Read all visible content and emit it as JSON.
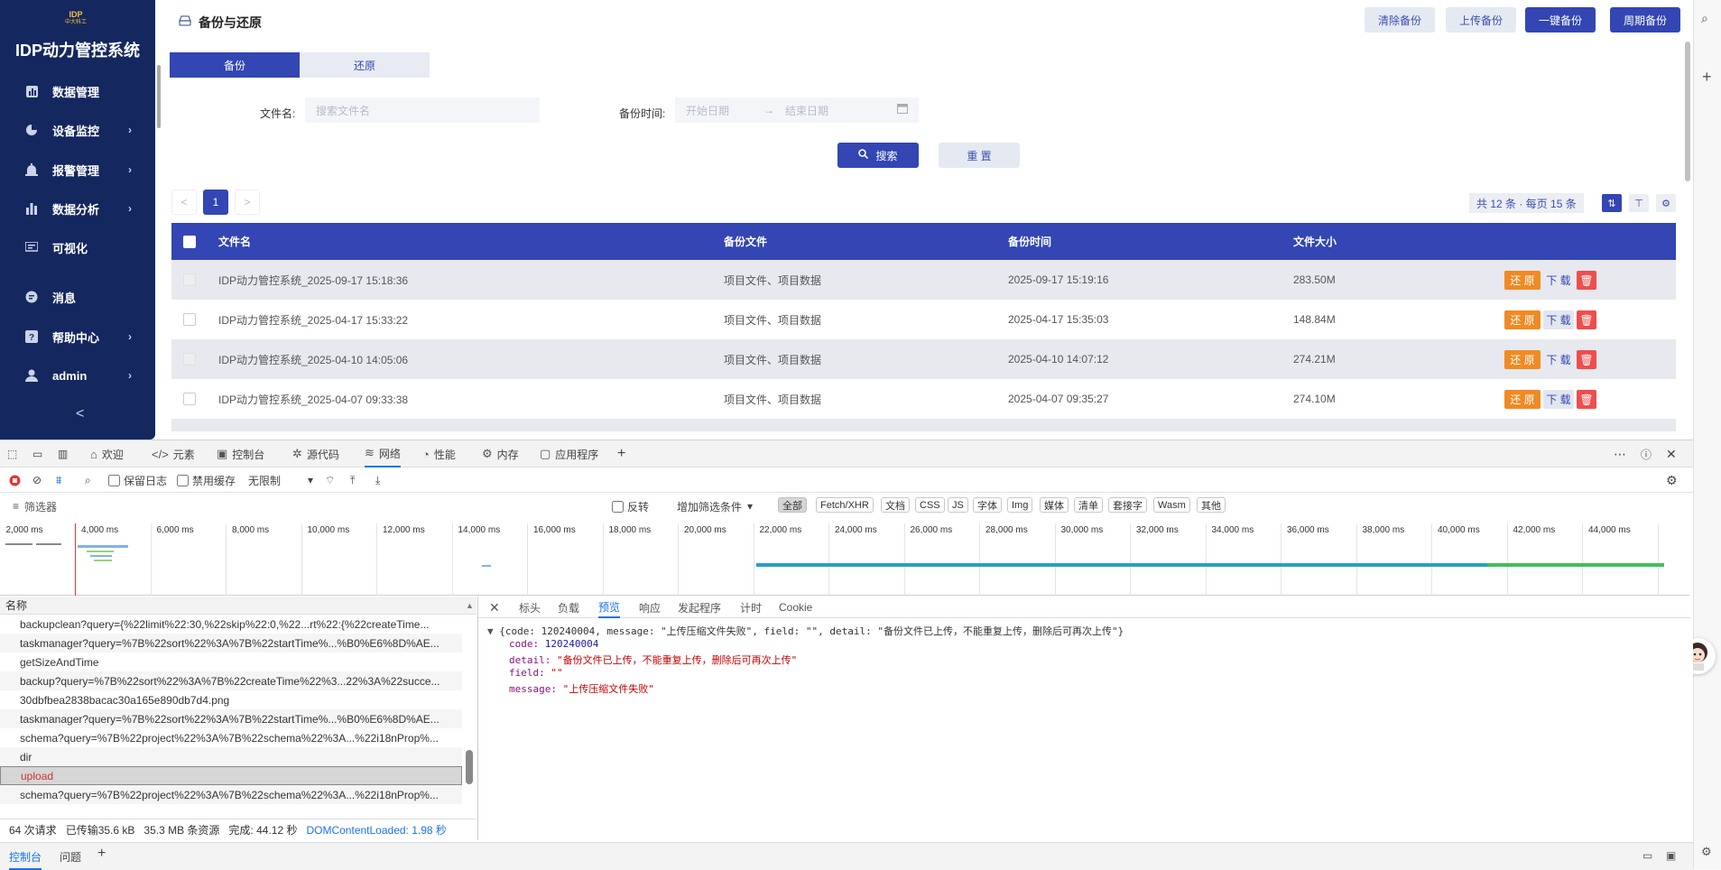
{
  "app": {
    "logo_text": "IDP",
    "logo_sub": "中大科工",
    "title": "IDP动力管控系统",
    "menu": [
      {
        "label": "数据管理",
        "icon": "bar-chart-icon",
        "arrow": false
      },
      {
        "label": "设备监控",
        "icon": "monitor-icon",
        "arrow": true
      },
      {
        "label": "报警管理",
        "icon": "alarm-icon",
        "arrow": true
      },
      {
        "label": "数据分析",
        "icon": "analysis-icon",
        "arrow": true
      },
      {
        "label": "可视化",
        "icon": "screen-icon",
        "arrow": false
      },
      {
        "label": "消息",
        "icon": "message-icon",
        "arrow": false
      },
      {
        "label": "帮助中心",
        "icon": "help-icon",
        "arrow": true
      },
      {
        "label": "admin",
        "icon": "user-icon",
        "arrow": true
      }
    ],
    "collapse_glyph": "<"
  },
  "page": {
    "title": "备份与还原",
    "actions": [
      "清除备份",
      "上传备份",
      "一键备份",
      "周期备份"
    ],
    "tabs": [
      "备份",
      "还原"
    ],
    "filters": {
      "file_label": "文件名:",
      "file_placeholder": "搜索文件名",
      "time_label": "备份时间:",
      "start_placeholder": "开始日期",
      "end_placeholder": "结束日期",
      "range_sep": "→",
      "search_button": "搜索",
      "reset_button": "重 置"
    },
    "pager": {
      "prev": "<",
      "current": "1",
      "next": ">",
      "summary": "共 12 条 · 每页 15 条"
    },
    "table": {
      "headers": [
        "文件名",
        "备份文件",
        "备份时间",
        "文件大小"
      ],
      "rows": [
        {
          "name": "IDP动力管控系统_2025-09-17 15:18:36",
          "content": "项目文件、项目数据",
          "time": "2025-09-17 15:19:16",
          "size": "283.50M"
        },
        {
          "name": "IDP动力管控系统_2025-04-17 15:33:22",
          "content": "项目文件、项目数据",
          "time": "2025-04-17 15:35:03",
          "size": "148.84M"
        },
        {
          "name": "IDP动力管控系统_2025-04-10 14:05:06",
          "content": "项目文件、项目数据",
          "time": "2025-04-10 14:07:12",
          "size": "274.21M"
        },
        {
          "name": "IDP动力管控系统_2025-04-07 09:33:38",
          "content": "项目文件、项目数据",
          "time": "2025-04-07 09:35:27",
          "size": "274.10M"
        }
      ],
      "ops": {
        "restore": "还 原",
        "download": "下 载"
      }
    }
  },
  "devtools": {
    "tabs": [
      "欢迎",
      "元素",
      "控制台",
      "源代码",
      "网络",
      "性能",
      "内存",
      "应用程序"
    ],
    "active_tab": "网络",
    "toolbar": {
      "preserve_log": "保留日志",
      "disable_cache": "禁用缓存",
      "throttle": "无限制"
    },
    "filter": {
      "placeholder": "筛选器",
      "invert": "反转",
      "more_filters": "增加筛选条件"
    },
    "type_chips": [
      "全部",
      "Fetch/XHR",
      "文档",
      "CSS",
      "JS",
      "字体",
      "Img",
      "媒体",
      "清单",
      "套接字",
      "Wasm",
      "其他"
    ],
    "timeline_ticks": [
      "2,000 ms",
      "4,000 ms",
      "6,000 ms",
      "8,000 ms",
      "10,000 ms",
      "12,000 ms",
      "14,000 ms",
      "16,000 ms",
      "18,000 ms",
      "20,000 ms",
      "22,000 ms",
      "24,000 ms",
      "26,000 ms",
      "28,000 ms",
      "30,000 ms",
      "32,000 ms",
      "34,000 ms",
      "36,000 ms",
      "38,000 ms",
      "40,000 ms",
      "42,000 ms",
      "44,000 ms"
    ],
    "name_header": "名称",
    "requests": [
      "backupclean?query={%22limit%22:30,%22skip%22:0,%22...rt%22:{%22createTime...",
      "taskmanager?query=%7B%22sort%22%3A%7B%22startTime%...%B0%E6%8D%AE...",
      "getSizeAndTime",
      "backup?query=%7B%22sort%22%3A%7B%22createTime%22%3...22%3A%22succe...",
      "30dbfbea2838bacac30a165e890db7d4.png",
      "taskmanager?query=%7B%22sort%22%3A%7B%22startTime%...%B0%E6%8D%AE...",
      "schema?query=%7B%22project%22%3A%7B%22schema%22%3A...%22i18nProp%...",
      "dir",
      "upload",
      "schema?query=%7B%22project%22%3A%7B%22schema%22%3A...%22i18nProp%..."
    ],
    "selected_request": "upload",
    "status": {
      "requests": "64 次请求",
      "transferred": "已传输35.6 kB",
      "resources": "35.3 MB 条资源",
      "finish": "完成: 44.12 秒",
      "dcl": "DOMContentLoaded: 1.98 秒"
    },
    "detail_tabs": [
      "标头",
      "负载",
      "预览",
      "响应",
      "发起程序",
      "计时",
      "Cookie"
    ],
    "active_detail": "预览",
    "preview": {
      "summary": "{code: 120240004, message: \"上传压缩文件失败\", field: \"\", detail: \"备份文件已上传，不能重复上传，删除后可再次上传\"}",
      "code": "120240004",
      "detail": "\"备份文件已上传，不能重复上传，删除后可再次上传\"",
      "field": "\"\"",
      "message": "\"上传压缩文件失败\""
    },
    "drawer_tabs": [
      "控制台",
      "问题"
    ]
  },
  "colors": {
    "primary": "#3346b3",
    "sidebar": "#15275f",
    "restore": "#f08a24",
    "delete": "#f04d4d"
  }
}
